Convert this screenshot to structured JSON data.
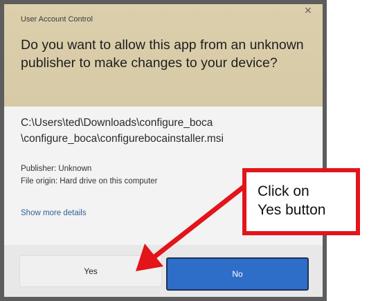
{
  "dialog": {
    "title": "User Account Control",
    "question": "Do you want to allow this app from an unknown publisher to make changes to your device?",
    "path_line1": "C:\\Users\\ted\\Downloads\\configure_boca",
    "path_line2": "\\configure_boca\\configurebocainstaller.msi",
    "publisher": "Publisher: Unknown",
    "file_origin": "File origin: Hard drive on this computer",
    "show_more": "Show more details",
    "yes_label": "Yes",
    "no_label": "No",
    "close_icon": "close-icon"
  },
  "annotation": {
    "line1": "Click on",
    "line2": "Yes button",
    "color": "#e3141a"
  },
  "colors": {
    "header_bg": "#dccfab",
    "accent": "#2f6ec8",
    "link": "#2f5f9a"
  }
}
